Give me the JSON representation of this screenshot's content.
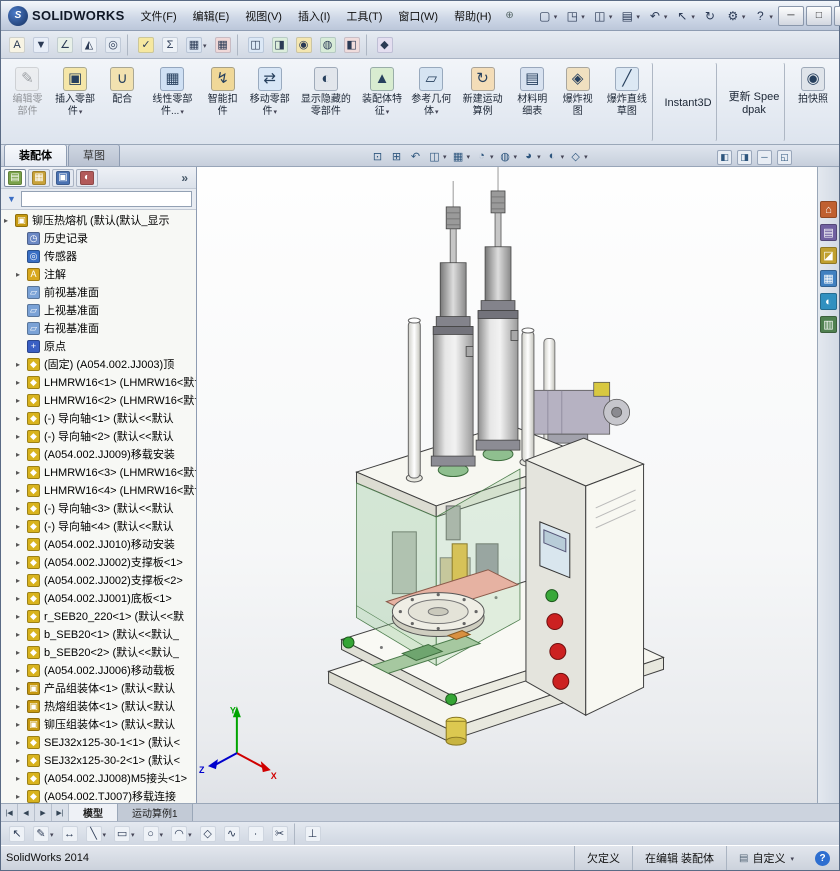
{
  "titlebar": {
    "brand_mark": "S",
    "brand": "SOLIDWORKS",
    "menus": [
      {
        "name": "menu-file",
        "label": "文件(F)"
      },
      {
        "name": "menu-edit",
        "label": "编辑(E)"
      },
      {
        "name": "menu-view",
        "label": "视图(V)"
      },
      {
        "name": "menu-insert",
        "label": "插入(I)"
      },
      {
        "name": "menu-tools",
        "label": "工具(T)"
      },
      {
        "name": "menu-window",
        "label": "窗口(W)"
      },
      {
        "name": "menu-help",
        "label": "帮助(H)"
      }
    ],
    "quick_tools": [
      {
        "name": "new-document-icon",
        "glyph": "▢",
        "dropdown": true
      },
      {
        "name": "open-document-icon",
        "glyph": "◳",
        "dropdown": true
      },
      {
        "name": "save-icon",
        "glyph": "◫",
        "dropdown": true
      },
      {
        "name": "print-icon",
        "glyph": "▤",
        "dropdown": true
      },
      {
        "name": "undo-icon",
        "glyph": "↶",
        "dropdown": true
      },
      {
        "name": "select-icon",
        "glyph": "↖",
        "dropdown": true
      },
      {
        "name": "rebuild-icon",
        "glyph": "↻",
        "dropdown": false
      },
      {
        "name": "options-icon",
        "glyph": "⚙",
        "dropdown": true
      },
      {
        "name": "help-icon",
        "glyph": "?",
        "dropdown": true
      }
    ],
    "window_buttons": [
      {
        "name": "minimize-button",
        "glyph": "─"
      },
      {
        "name": "maximize-button",
        "glyph": "□"
      },
      {
        "name": "close-button",
        "glyph": "×"
      }
    ]
  },
  "toolbar2": {
    "icons": [
      {
        "name": "spell-checker-icon",
        "glyph": "A",
        "bg": "#f8f4e4"
      },
      {
        "name": "selection-filter-icon",
        "glyph": "▼",
        "bg": "#e8eef8"
      },
      {
        "name": "measure-icon",
        "glyph": "∠",
        "bg": "#e8f0e8"
      },
      {
        "name": "mass-properties-icon",
        "glyph": "◭",
        "bg": "#eef2f7"
      },
      {
        "name": "performance-evaluation-icon",
        "glyph": "◎",
        "bg": "#e6ecf4",
        "sep": true
      },
      {
        "name": "check-document-icon",
        "glyph": "✓",
        "bg": "#f6e8a0"
      },
      {
        "name": "equations-icon",
        "glyph": "Σ",
        "bg": "#eef2f7"
      },
      {
        "name": "design-table-icon",
        "glyph": "▦",
        "bg": "#dde6f2",
        "dropdown": true
      },
      {
        "name": "export-table-icon",
        "glyph": "▦",
        "bg": "#f0d8d8",
        "sep": true
      },
      {
        "name": "interference-detection-icon",
        "glyph": "◫",
        "bg": "#dce8f6"
      },
      {
        "name": "clearance-verification-icon",
        "glyph": "◨",
        "bg": "#dceedc"
      },
      {
        "name": "hole-alignment-icon",
        "glyph": "◉",
        "bg": "#f4e6b0"
      },
      {
        "name": "assembly-visualization-icon",
        "glyph": "◍",
        "bg": "#d8ecd8"
      },
      {
        "name": "compare-icon",
        "glyph": "◧",
        "bg": "#f0dcdc",
        "sep": true
      },
      {
        "name": "appearance-icon",
        "glyph": "◆",
        "bg": "#e4def0"
      }
    ]
  },
  "command_manager": {
    "buttons": [
      {
        "name": "edit-component-button",
        "label": "编辑零部件",
        "glyph": "✎",
        "bg": "#e9e9e9",
        "disabled": true
      },
      {
        "name": "insert-components-button",
        "label": "插入零部件",
        "glyph": "▣",
        "bg": "#f5e6a8",
        "dropdown": true
      },
      {
        "name": "mate-button",
        "label": "配合",
        "glyph": "∪",
        "bg": "#f2e2b0"
      },
      {
        "name": "linear-component-pattern-button",
        "label": "线性零部件...",
        "glyph": "▦",
        "bg": "#cfe0f4",
        "dropdown": true
      },
      {
        "name": "smart-fasteners-button",
        "label": "智能扣件",
        "glyph": "↯",
        "bg": "#f0d898"
      },
      {
        "name": "move-component-button",
        "label": "移动零部件",
        "glyph": "⇄",
        "bg": "#d8e6f6",
        "dropdown": true
      },
      {
        "name": "show-hidden-components-button",
        "label": "显示隐藏的零部件",
        "glyph": "◐",
        "bg": "#e2e6ec"
      },
      {
        "name": "assembly-features-button",
        "label": "装配体特征",
        "glyph": "▲",
        "bg": "#d8ecd0",
        "dropdown": true
      },
      {
        "name": "reference-geometry-button",
        "label": "参考几何体",
        "glyph": "▱",
        "bg": "#d6e4f2",
        "dropdown": true
      },
      {
        "name": "new-motion-study-button",
        "label": "新建运动算例",
        "glyph": "↻",
        "bg": "#f4ddb8"
      },
      {
        "name": "bill-of-materials-button",
        "label": "材料明细表",
        "glyph": "▤",
        "bg": "#d8e2f0"
      },
      {
        "name": "exploded-view-button",
        "label": "爆炸视图",
        "glyph": "◈",
        "bg": "#f0e0c0"
      },
      {
        "name": "explode-line-sketch-button",
        "label": "爆炸直线草图",
        "glyph": "╱",
        "bg": "#dce8f4",
        "sep": true
      },
      {
        "name": "instant3d-button",
        "label": "Instant3D",
        "textonly": true,
        "sep": true
      },
      {
        "name": "update-speedpak-button",
        "label": "更新 Speedpak",
        "textonly": true,
        "sep": true
      },
      {
        "name": "take-snapshot-button",
        "label": "拍快照",
        "glyph": "◉",
        "bg": "#dfe4ea"
      }
    ],
    "tabs": [
      {
        "name": "tab-assembly",
        "label": "装配体",
        "active": true
      },
      {
        "name": "tab-sketch",
        "label": "草图",
        "active": false
      }
    ]
  },
  "viewport": {
    "headsup": [
      {
        "name": "zoom-fit-icon",
        "glyph": "⊡"
      },
      {
        "name": "zoom-area-icon",
        "glyph": "⊞"
      },
      {
        "name": "previous-view-icon",
        "glyph": "↶"
      },
      {
        "name": "section-view-icon",
        "glyph": "◫",
        "dropdown": true
      },
      {
        "name": "view-orientation-icon",
        "glyph": "▦",
        "dropdown": true
      },
      {
        "name": "display-style-icon",
        "glyph": "◔",
        "dropdown": true
      },
      {
        "name": "hide-show-items-icon",
        "glyph": "◍",
        "dropdown": true
      },
      {
        "name": "edit-appearance-icon",
        "glyph": "◕",
        "dropdown": true
      },
      {
        "name": "apply-scene-icon",
        "glyph": "◐",
        "dropdown": true
      },
      {
        "name": "view-settings-icon",
        "glyph": "◇",
        "dropdown": true
      }
    ],
    "corner_icons": [
      {
        "name": "pane-split-left-icon",
        "glyph": "◧"
      },
      {
        "name": "pane-split-right-icon",
        "glyph": "◨"
      },
      {
        "name": "document-minimize-icon",
        "glyph": "─"
      },
      {
        "name": "document-restore-icon",
        "glyph": "◱"
      }
    ],
    "triad": {
      "x": "X",
      "y": "Y",
      "z": "Z"
    }
  },
  "panel": {
    "tabs": [
      {
        "name": "featuremanager-tab",
        "glyph": "▤",
        "bg": "#7aa24a",
        "active": true
      },
      {
        "name": "propertymanager-tab",
        "glyph": "▦",
        "bg": "#c8a23a"
      },
      {
        "name": "configurationmanager-tab",
        "glyph": "▣",
        "bg": "#4a72b2"
      },
      {
        "name": "displaymanager-tab",
        "glyph": "◐",
        "bg": "#b25a5a"
      }
    ]
  },
  "tree": {
    "items": [
      {
        "cls": "root",
        "g": "▣",
        "c": "#c79a12",
        "exp": true,
        "label": "铆压热熔机 (默认(默认_显示"
      },
      {
        "cls": "child",
        "g": "◷",
        "c": "#6b88c4",
        "exp": false,
        "label": "历史记录"
      },
      {
        "cls": "child",
        "g": "◎",
        "c": "#3a6fc4",
        "exp": false,
        "label": "传感器"
      },
      {
        "cls": "child",
        "g": "A",
        "c": "#d8a81e",
        "exp": true,
        "label": "注解"
      },
      {
        "cls": "child",
        "g": "▱",
        "c": "#7aa2d6",
        "exp": false,
        "label": "前视基准面"
      },
      {
        "cls": "child",
        "g": "▱",
        "c": "#7aa2d6",
        "exp": false,
        "label": "上视基准面"
      },
      {
        "cls": "child",
        "g": "▱",
        "c": "#7aa2d6",
        "exp": false,
        "label": "右视基准面"
      },
      {
        "cls": "child",
        "g": "+",
        "c": "#3a5fc4",
        "exp": false,
        "label": "原点"
      },
      {
        "cls": "child",
        "g": "◆",
        "c": "#d8b31e",
        "exp": true,
        "label": "(固定) (A054.002.JJ003)顶"
      },
      {
        "cls": "child",
        "g": "◆",
        "c": "#d8b31e",
        "exp": true,
        "label": "LHMRW16<1> (LHMRW16<默认"
      },
      {
        "cls": "child",
        "g": "◆",
        "c": "#d8b31e",
        "exp": true,
        "label": "LHMRW16<2> (LHMRW16<默认"
      },
      {
        "cls": "child",
        "g": "◆",
        "c": "#d8b31e",
        "exp": true,
        "label": "(-) 导向轴<1> (默认<<默认"
      },
      {
        "cls": "child",
        "g": "◆",
        "c": "#d8b31e",
        "exp": true,
        "label": "(-) 导向轴<2> (默认<<默认"
      },
      {
        "cls": "child",
        "g": "◆",
        "c": "#d8b31e",
        "exp": true,
        "label": "(A054.002.JJ009)移载安装"
      },
      {
        "cls": "child",
        "g": "◆",
        "c": "#d8b31e",
        "exp": true,
        "label": "LHMRW16<3> (LHMRW16<默认"
      },
      {
        "cls": "child",
        "g": "◆",
        "c": "#d8b31e",
        "exp": true,
        "label": "LHMRW16<4> (LHMRW16<默认"
      },
      {
        "cls": "child",
        "g": "◆",
        "c": "#d8b31e",
        "exp": true,
        "label": "(-) 导向轴<3> (默认<<默认"
      },
      {
        "cls": "child",
        "g": "◆",
        "c": "#d8b31e",
        "exp": true,
        "label": "(-) 导向轴<4> (默认<<默认"
      },
      {
        "cls": "child",
        "g": "◆",
        "c": "#d8b31e",
        "exp": true,
        "label": "(A054.002.JJ010)移动安装"
      },
      {
        "cls": "child",
        "g": "◆",
        "c": "#d8b31e",
        "exp": true,
        "label": "(A054.002.JJ002)支撑板<1>"
      },
      {
        "cls": "child",
        "g": "◆",
        "c": "#d8b31e",
        "exp": true,
        "label": "(A054.002.JJ002)支撑板<2>"
      },
      {
        "cls": "child",
        "g": "◆",
        "c": "#d8b31e",
        "exp": true,
        "label": "(A054.002.JJ001)底板<1>"
      },
      {
        "cls": "child",
        "g": "◆",
        "c": "#d8b31e",
        "exp": true,
        "label": "r_SEB20_220<1> (默认<<默"
      },
      {
        "cls": "child",
        "g": "◆",
        "c": "#d8b31e",
        "exp": true,
        "label": "b_SEB20<1> (默认<<默认_"
      },
      {
        "cls": "child",
        "g": "◆",
        "c": "#d8b31e",
        "exp": true,
        "label": "b_SEB20<2> (默认<<默认_"
      },
      {
        "cls": "child",
        "g": "◆",
        "c": "#d8b31e",
        "exp": true,
        "label": "(A054.002.JJ006)移动载板"
      },
      {
        "cls": "child",
        "g": "▣",
        "c": "#c79a12",
        "exp": true,
        "label": "产品组装体<1> (默认<默认"
      },
      {
        "cls": "child",
        "g": "▣",
        "c": "#c79a12",
        "exp": true,
        "label": "热熔组装体<1> (默认<默认"
      },
      {
        "cls": "child",
        "g": "▣",
        "c": "#c79a12",
        "exp": true,
        "label": "铆压组装体<1> (默认<默认"
      },
      {
        "cls": "child",
        "g": "◆",
        "c": "#d8b31e",
        "exp": true,
        "label": "SEJ32x125-30-1<1> (默认<"
      },
      {
        "cls": "child",
        "g": "◆",
        "c": "#d8b31e",
        "exp": true,
        "label": "SEJ32x125-30-2<1> (默认<"
      },
      {
        "cls": "child",
        "g": "◆",
        "c": "#d8b31e",
        "exp": true,
        "label": "(A054.002.JJ008)M5接头<1>"
      },
      {
        "cls": "child",
        "g": "◆",
        "c": "#d8b31e",
        "exp": true,
        "label": "(A054.002.TJ007)移载连接"
      }
    ]
  },
  "taskpane": {
    "icons": [
      {
        "name": "solidworks-resources-icon",
        "glyph": "⌂",
        "c": "#c06030"
      },
      {
        "name": "design-library-icon",
        "glyph": "▤",
        "c": "#7060a0"
      },
      {
        "name": "file-explorer-icon",
        "glyph": "◪",
        "c": "#c0a030"
      },
      {
        "name": "view-palette-icon",
        "glyph": "▦",
        "c": "#4080c0"
      },
      {
        "name": "appearances-scenes-icon",
        "glyph": "◐",
        "c": "#3090c0"
      },
      {
        "name": "custom-properties-icon",
        "glyph": "▥",
        "c": "#508050"
      }
    ]
  },
  "bottom": {
    "nav_icons": [
      {
        "name": "first-tab-icon",
        "glyph": "|◀"
      },
      {
        "name": "previous-tab-icon",
        "glyph": "◀"
      },
      {
        "name": "next-tab-icon",
        "glyph": "▶"
      },
      {
        "name": "last-tab-icon",
        "glyph": "▶|"
      }
    ],
    "tabs": [
      {
        "name": "tab-model",
        "label": "模型",
        "active": true
      },
      {
        "name": "tab-motion-study-1",
        "label": "运动算例1",
        "active": false
      }
    ],
    "sketch_icons": [
      {
        "name": "select-tool-icon",
        "glyph": "↖"
      },
      {
        "name": "sketch-tool-icon",
        "glyph": "✎",
        "dropdown": true
      },
      {
        "name": "smart-dimension-icon",
        "glyph": "↔"
      },
      {
        "name": "line-tool-icon",
        "glyph": "╲",
        "dropdown": true
      },
      {
        "name": "rectangle-tool-icon",
        "glyph": "▭",
        "dropdown": true
      },
      {
        "name": "circle-tool-icon",
        "glyph": "○",
        "dropdown": true
      },
      {
        "name": "arc-tool-icon",
        "glyph": "◠",
        "dropdown": true
      },
      {
        "name": "polygon-tool-icon",
        "glyph": "◇"
      },
      {
        "name": "spline-tool-icon",
        "glyph": "∿"
      },
      {
        "name": "point-tool-icon",
        "glyph": "∙"
      },
      {
        "name": "trim-entities-icon",
        "glyph": "✂",
        "sep": true
      },
      {
        "name": "display-relations-icon",
        "glyph": "⊥"
      }
    ]
  },
  "statusbar": {
    "app_version": "SolidWorks 2014",
    "define_state": "欠定义",
    "editing_state": "在编辑 装配体",
    "custom_label": "自定义",
    "help_glyph": "?"
  }
}
